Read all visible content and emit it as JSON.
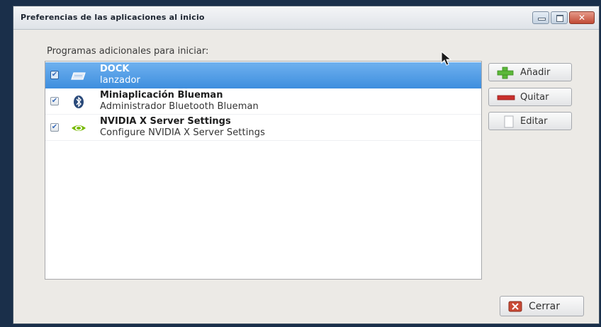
{
  "window": {
    "title": "Preferencias de las aplicaciones al inicio",
    "controls": {
      "minimize": "minimize-icon",
      "maximize": "maximize-icon",
      "close": "close-icon"
    }
  },
  "main": {
    "caption": "Programas adicionales para iniciar:",
    "items": [
      {
        "name": "DOCK",
        "description": "lanzador",
        "checked": true,
        "selected": true,
        "icon": "launcher-icon"
      },
      {
        "name": "Miniaplicación Blueman",
        "description": "Administrador Bluetooth Blueman",
        "checked": true,
        "selected": false,
        "icon": "bluetooth-icon"
      },
      {
        "name": "NVIDIA X Server Settings",
        "description": "Configure NVIDIA X Server Settings",
        "checked": true,
        "selected": false,
        "icon": "nvidia-icon"
      }
    ]
  },
  "buttons": {
    "add": "Añadir",
    "remove": "Quitar",
    "edit": "Editar",
    "close": "Cerrar"
  },
  "colors": {
    "selection": "#4a98e4",
    "add_icon": "#5cb83a",
    "remove_icon": "#c9302c",
    "close_icon": "#c94a35"
  }
}
